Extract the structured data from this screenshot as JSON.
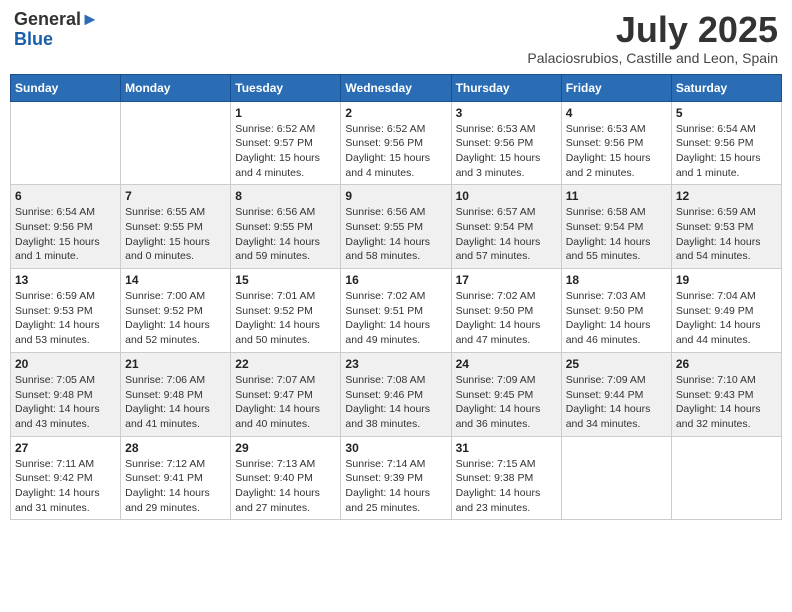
{
  "header": {
    "logo_line1": "General",
    "logo_line2": "Blue",
    "month_title": "July 2025",
    "location": "Palaciosrubios, Castille and Leon, Spain"
  },
  "weekdays": [
    "Sunday",
    "Monday",
    "Tuesday",
    "Wednesday",
    "Thursday",
    "Friday",
    "Saturday"
  ],
  "weeks": [
    [
      {
        "day": "",
        "info": ""
      },
      {
        "day": "",
        "info": ""
      },
      {
        "day": "1",
        "info": "Sunrise: 6:52 AM\nSunset: 9:57 PM\nDaylight: 15 hours and 4 minutes."
      },
      {
        "day": "2",
        "info": "Sunrise: 6:52 AM\nSunset: 9:56 PM\nDaylight: 15 hours and 4 minutes."
      },
      {
        "day": "3",
        "info": "Sunrise: 6:53 AM\nSunset: 9:56 PM\nDaylight: 15 hours and 3 minutes."
      },
      {
        "day": "4",
        "info": "Sunrise: 6:53 AM\nSunset: 9:56 PM\nDaylight: 15 hours and 2 minutes."
      },
      {
        "day": "5",
        "info": "Sunrise: 6:54 AM\nSunset: 9:56 PM\nDaylight: 15 hours and 1 minute."
      }
    ],
    [
      {
        "day": "6",
        "info": "Sunrise: 6:54 AM\nSunset: 9:56 PM\nDaylight: 15 hours and 1 minute."
      },
      {
        "day": "7",
        "info": "Sunrise: 6:55 AM\nSunset: 9:55 PM\nDaylight: 15 hours and 0 minutes."
      },
      {
        "day": "8",
        "info": "Sunrise: 6:56 AM\nSunset: 9:55 PM\nDaylight: 14 hours and 59 minutes."
      },
      {
        "day": "9",
        "info": "Sunrise: 6:56 AM\nSunset: 9:55 PM\nDaylight: 14 hours and 58 minutes."
      },
      {
        "day": "10",
        "info": "Sunrise: 6:57 AM\nSunset: 9:54 PM\nDaylight: 14 hours and 57 minutes."
      },
      {
        "day": "11",
        "info": "Sunrise: 6:58 AM\nSunset: 9:54 PM\nDaylight: 14 hours and 55 minutes."
      },
      {
        "day": "12",
        "info": "Sunrise: 6:59 AM\nSunset: 9:53 PM\nDaylight: 14 hours and 54 minutes."
      }
    ],
    [
      {
        "day": "13",
        "info": "Sunrise: 6:59 AM\nSunset: 9:53 PM\nDaylight: 14 hours and 53 minutes."
      },
      {
        "day": "14",
        "info": "Sunrise: 7:00 AM\nSunset: 9:52 PM\nDaylight: 14 hours and 52 minutes."
      },
      {
        "day": "15",
        "info": "Sunrise: 7:01 AM\nSunset: 9:52 PM\nDaylight: 14 hours and 50 minutes."
      },
      {
        "day": "16",
        "info": "Sunrise: 7:02 AM\nSunset: 9:51 PM\nDaylight: 14 hours and 49 minutes."
      },
      {
        "day": "17",
        "info": "Sunrise: 7:02 AM\nSunset: 9:50 PM\nDaylight: 14 hours and 47 minutes."
      },
      {
        "day": "18",
        "info": "Sunrise: 7:03 AM\nSunset: 9:50 PM\nDaylight: 14 hours and 46 minutes."
      },
      {
        "day": "19",
        "info": "Sunrise: 7:04 AM\nSunset: 9:49 PM\nDaylight: 14 hours and 44 minutes."
      }
    ],
    [
      {
        "day": "20",
        "info": "Sunrise: 7:05 AM\nSunset: 9:48 PM\nDaylight: 14 hours and 43 minutes."
      },
      {
        "day": "21",
        "info": "Sunrise: 7:06 AM\nSunset: 9:48 PM\nDaylight: 14 hours and 41 minutes."
      },
      {
        "day": "22",
        "info": "Sunrise: 7:07 AM\nSunset: 9:47 PM\nDaylight: 14 hours and 40 minutes."
      },
      {
        "day": "23",
        "info": "Sunrise: 7:08 AM\nSunset: 9:46 PM\nDaylight: 14 hours and 38 minutes."
      },
      {
        "day": "24",
        "info": "Sunrise: 7:09 AM\nSunset: 9:45 PM\nDaylight: 14 hours and 36 minutes."
      },
      {
        "day": "25",
        "info": "Sunrise: 7:09 AM\nSunset: 9:44 PM\nDaylight: 14 hours and 34 minutes."
      },
      {
        "day": "26",
        "info": "Sunrise: 7:10 AM\nSunset: 9:43 PM\nDaylight: 14 hours and 32 minutes."
      }
    ],
    [
      {
        "day": "27",
        "info": "Sunrise: 7:11 AM\nSunset: 9:42 PM\nDaylight: 14 hours and 31 minutes."
      },
      {
        "day": "28",
        "info": "Sunrise: 7:12 AM\nSunset: 9:41 PM\nDaylight: 14 hours and 29 minutes."
      },
      {
        "day": "29",
        "info": "Sunrise: 7:13 AM\nSunset: 9:40 PM\nDaylight: 14 hours and 27 minutes."
      },
      {
        "day": "30",
        "info": "Sunrise: 7:14 AM\nSunset: 9:39 PM\nDaylight: 14 hours and 25 minutes."
      },
      {
        "day": "31",
        "info": "Sunrise: 7:15 AM\nSunset: 9:38 PM\nDaylight: 14 hours and 23 minutes."
      },
      {
        "day": "",
        "info": ""
      },
      {
        "day": "",
        "info": ""
      }
    ]
  ]
}
